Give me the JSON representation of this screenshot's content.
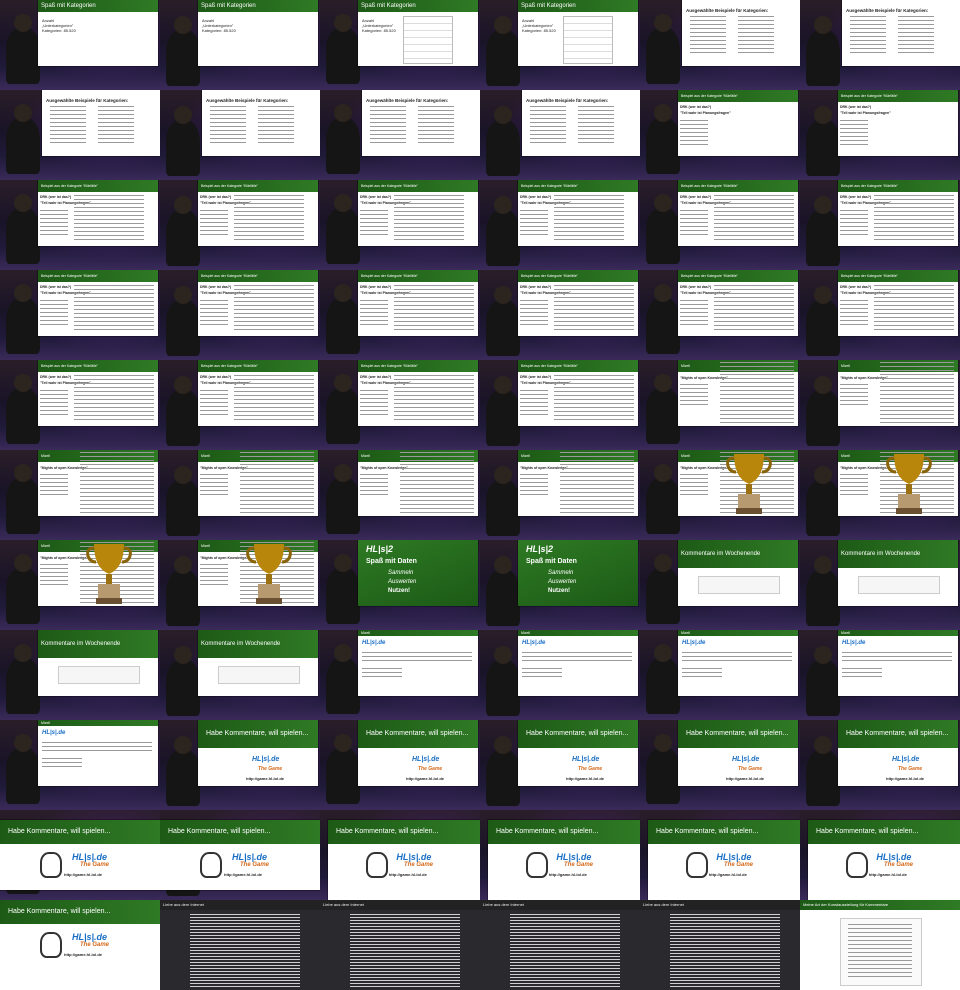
{
  "title_kategorien": "Spaß mit Kategorien",
  "title_beispiel": "Beispiel aus der Kategorie “Klärfälle”",
  "title_beispiel_short": "Beispiel aus der Kategorie “Klärfälle”",
  "title_wiki": "Mizell",
  "title_kommentare": "Kommentare im Wochenende",
  "title_habe": "Habe Kommentare, will spielen...",
  "title_liebe": "Liebe aus dem Internet",
  "title_kunst": "Meine Art der Kunstausstellung für Kommentare",
  "spass_daten": "Spaß mit Daten",
  "sammeln": "Sammeln",
  "auswerten": "Auswerten",
  "nutzen": "Nutzen!",
  "logo_hl2": "HL|s|2",
  "logo_hlde": "HL|s|.de",
  "logo_game": "The Game",
  "url_game": "http://game.hl-lol.de",
  "kategorien_lines": [
    "Anzahl",
    "„Unterkategorien\"",
    "Kategorien: 85.520"
  ],
  "ausgewaehlte": "Ausgewählte Beispiele für Kategorien:",
  "drk_lines": [
    "DRK (wer ist das?)",
    "\"Tell wahr ist Planungsfragen\""
  ],
  "mighty_lines": [
    "\"Mights of open Knowledge\""
  ],
  "thumbnails": {
    "rows": 11,
    "cols": 6,
    "kinds": [
      "kat-empty",
      "kat-empty",
      "kat-table",
      "kat-table",
      "kat-list",
      "kat-list",
      "kat-list",
      "kat-list",
      "kat-list",
      "kat-list",
      "bsp-side",
      "bsp-side",
      "bsp-text",
      "bsp-text",
      "bsp-text",
      "bsp-text",
      "bsp-drk",
      "bsp-drk",
      "bsp-drk",
      "bsp-drk",
      "bsp-drk",
      "bsp-drk",
      "bsp-drk",
      "bsp-drk",
      "bsp-drk",
      "bsp-drk",
      "bsp-drk",
      "bsp-drk",
      "wiki",
      "wiki",
      "wiki",
      "wiki",
      "wiki",
      "wiki",
      "cup",
      "cup",
      "cup",
      "cup",
      "green",
      "green",
      "komm",
      "komm",
      "komm",
      "komm",
      "forum",
      "forum",
      "forum",
      "forum",
      "forum",
      "habe",
      "habe",
      "habe",
      "habe",
      "habe",
      "habe-big",
      "habe-big",
      "habe-big-full",
      "habe-big-full",
      "habe-big-full",
      "habe-big-full",
      "habe-full",
      "liebe",
      "liebe",
      "liebe",
      "liebe",
      "kunst"
    ]
  }
}
